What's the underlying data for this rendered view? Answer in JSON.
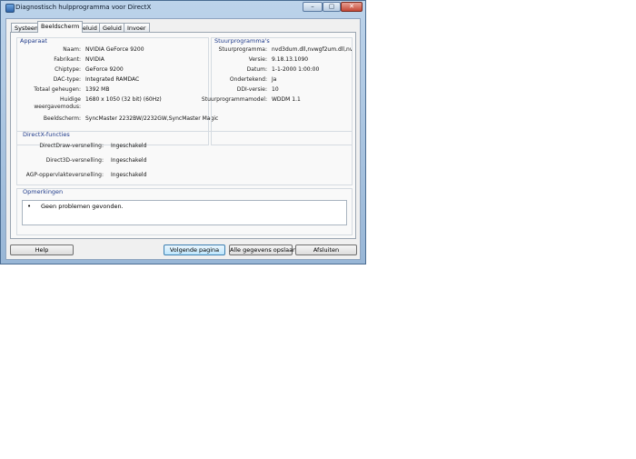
{
  "window": {
    "title": "Diagnostisch hulpprogramma voor DirectX",
    "controls": {
      "minimize": "–",
      "maximize": "▢",
      "close": "✕"
    }
  },
  "tabs": [
    {
      "label": "Systeem"
    },
    {
      "label": "Beeldscherm",
      "active": true
    },
    {
      "label": "Geluid 1"
    },
    {
      "label": "Geluid 2"
    },
    {
      "label": "Invoer"
    }
  ],
  "device": {
    "title": "Apparaat",
    "rows": [
      {
        "label": "Naam:",
        "value": "NVIDIA GeForce 9200"
      },
      {
        "label": "Fabrikant:",
        "value": "NVIDIA"
      },
      {
        "label": "Chiptype:",
        "value": "GeForce 9200"
      },
      {
        "label": "DAC-type:",
        "value": "Integrated RAMDAC"
      },
      {
        "label": "Totaal geheugen:",
        "value": "1392 MB"
      },
      {
        "label": "Huidige",
        "label2": "weergavemodus:",
        "value": "1680 x 1050 (32 bit) (60Hz)"
      },
      {
        "label": "Beeldscherm:",
        "value": "SyncMaster 2232BW/2232GW,SyncMaster Magic"
      }
    ]
  },
  "drivers": {
    "title": "Stuurprogramma's",
    "rows": [
      {
        "label": "Stuurprogramma:",
        "value": "nvd3dum.dll,nvwgf2um.dll,nvwgf2i"
      },
      {
        "label": "Versie:",
        "value": "9.18.13.1090"
      },
      {
        "label": "Datum:",
        "value": "1-1-2000 1:00:00"
      },
      {
        "label": "Ondertekend:",
        "value": "Ja"
      },
      {
        "label": "DDI-versie:",
        "value": "10"
      },
      {
        "label": "Stuurprogrammamodel:",
        "value": "WDDM 1.1"
      }
    ]
  },
  "directx": {
    "title": "DirectX-functies",
    "rows": [
      {
        "label": "DirectDraw-versnelling:",
        "value": "Ingeschakeld"
      },
      {
        "label": "Direct3D-versnelling:",
        "value": "Ingeschakeld"
      },
      {
        "label": "AGP-oppervlakteversnelling:",
        "value": "Ingeschakeld"
      }
    ]
  },
  "notes": {
    "title": "Opmerkingen",
    "bullet": "•",
    "text": "Geen problemen gevonden."
  },
  "buttons": {
    "help": "Help",
    "next": "Volgende pagina",
    "save_all": "Alle gegevens opslaan...",
    "exit": "Afsluiten"
  }
}
